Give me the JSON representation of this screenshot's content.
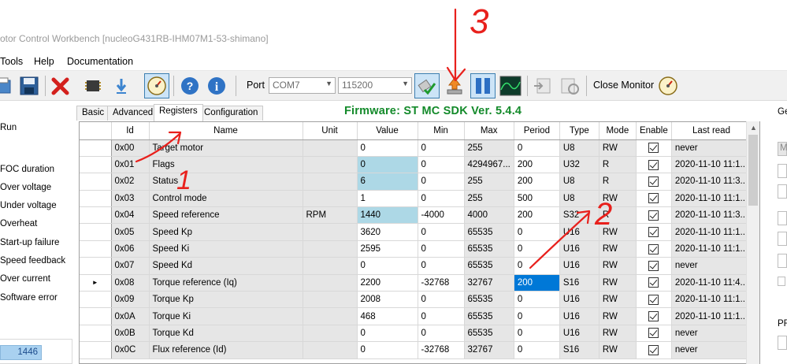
{
  "window": {
    "title": "otor Control Workbench [nucleoG431RB-IHM07M1-53-shimano]"
  },
  "menu": {
    "items": [
      "Tools",
      "Help",
      "Documentation"
    ]
  },
  "toolbar": {
    "port_label": "Port",
    "port_value": "COM7",
    "baud_value": "115200",
    "close_monitor_label": "Close Monitor"
  },
  "left_panel": {
    "status_items": [
      "Run",
      "FOC duration",
      "Over voltage",
      "Under voltage",
      "Overheat",
      "Start-up failure",
      "Speed feedback",
      "Over current",
      "Software error"
    ],
    "speed_value": "1446"
  },
  "tabs": [
    "Basic",
    "Advanced",
    "Registers",
    "Configuration"
  ],
  "active_tab": "Registers",
  "firmware_label": "Firmware: ST MC SDK Ver. 5.4.4",
  "table": {
    "columns": [
      "Id",
      "Name",
      "Unit",
      "Value",
      "Min",
      "Max",
      "Period",
      "Type",
      "Mode",
      "Enable",
      "Last read"
    ],
    "current_row_marker": "►",
    "rows": [
      {
        "id": "0x00",
        "name": "Target motor",
        "unit": "",
        "value": "0",
        "min": "0",
        "max": "255",
        "period": "0",
        "type": "U8",
        "mode": "RW",
        "enable": true,
        "last_read": "never"
      },
      {
        "id": "0x01",
        "name": "Flags",
        "unit": "",
        "value": "0",
        "min": "0",
        "max": "4294967...",
        "period": "200",
        "type": "U32",
        "mode": "R",
        "enable": true,
        "last_read": "2020-11-10 11:1..."
      },
      {
        "id": "0x02",
        "name": "Status",
        "unit": "",
        "value": "6",
        "min": "0",
        "max": "255",
        "period": "200",
        "type": "U8",
        "mode": "R",
        "enable": true,
        "last_read": "2020-11-10 11:3..."
      },
      {
        "id": "0x03",
        "name": "Control mode",
        "unit": "",
        "value": "1",
        "min": "0",
        "max": "255",
        "period": "500",
        "type": "U8",
        "mode": "RW",
        "enable": true,
        "last_read": "2020-11-10 11:1..."
      },
      {
        "id": "0x04",
        "name": "Speed reference",
        "unit": "RPM",
        "value": "1440",
        "min": "-4000",
        "max": "4000",
        "period": "200",
        "type": "S32",
        "mode": "R",
        "enable": true,
        "last_read": "2020-11-10 11:3..."
      },
      {
        "id": "0x05",
        "name": "Speed Kp",
        "unit": "",
        "value": "3620",
        "min": "0",
        "max": "65535",
        "period": "0",
        "type": "U16",
        "mode": "RW",
        "enable": true,
        "last_read": "2020-11-10 11:1..."
      },
      {
        "id": "0x06",
        "name": "Speed Ki",
        "unit": "",
        "value": "2595",
        "min": "0",
        "max": "65535",
        "period": "0",
        "type": "U16",
        "mode": "RW",
        "enable": true,
        "last_read": "2020-11-10 11:1..."
      },
      {
        "id": "0x07",
        "name": "Speed Kd",
        "unit": "",
        "value": "0",
        "min": "0",
        "max": "65535",
        "period": "0",
        "type": "U16",
        "mode": "RW",
        "enable": true,
        "last_read": "never"
      },
      {
        "id": "0x08",
        "name": "Torque reference (Iq)",
        "unit": "",
        "value": "2200",
        "min": "-32768",
        "max": "32767",
        "period": "200",
        "type": "S16",
        "mode": "RW",
        "enable": true,
        "last_read": "2020-11-10 11:4..."
      },
      {
        "id": "0x09",
        "name": "Torque Kp",
        "unit": "",
        "value": "2008",
        "min": "0",
        "max": "65535",
        "period": "0",
        "type": "U16",
        "mode": "RW",
        "enable": true,
        "last_read": "2020-11-10 11:1..."
      },
      {
        "id": "0x0A",
        "name": "Torque Ki",
        "unit": "",
        "value": "468",
        "min": "0",
        "max": "65535",
        "period": "0",
        "type": "U16",
        "mode": "RW",
        "enable": true,
        "last_read": "2020-11-10 11:1..."
      },
      {
        "id": "0x0B",
        "name": "Torque Kd",
        "unit": "",
        "value": "0",
        "min": "0",
        "max": "65535",
        "period": "0",
        "type": "U16",
        "mode": "RW",
        "enable": true,
        "last_read": "never"
      },
      {
        "id": "0x0C",
        "name": "Flux reference (Id)",
        "unit": "",
        "value": "0",
        "min": "-32768",
        "max": "32767",
        "period": "0",
        "type": "S16",
        "mode": "RW",
        "enable": true,
        "last_read": "never"
      }
    ]
  },
  "right_panel": {
    "header": "Ge",
    "bottom_header": "PF",
    "field_label": "M"
  },
  "annotations": {
    "marks": [
      "1",
      "2",
      "3"
    ],
    "color": "#e8201c"
  },
  "colors": {
    "firmware_green": "#138a2a",
    "selected_cell": "#add8e6",
    "current_cell": "#0078d7",
    "readonly_cell": "#e6e6e6"
  }
}
